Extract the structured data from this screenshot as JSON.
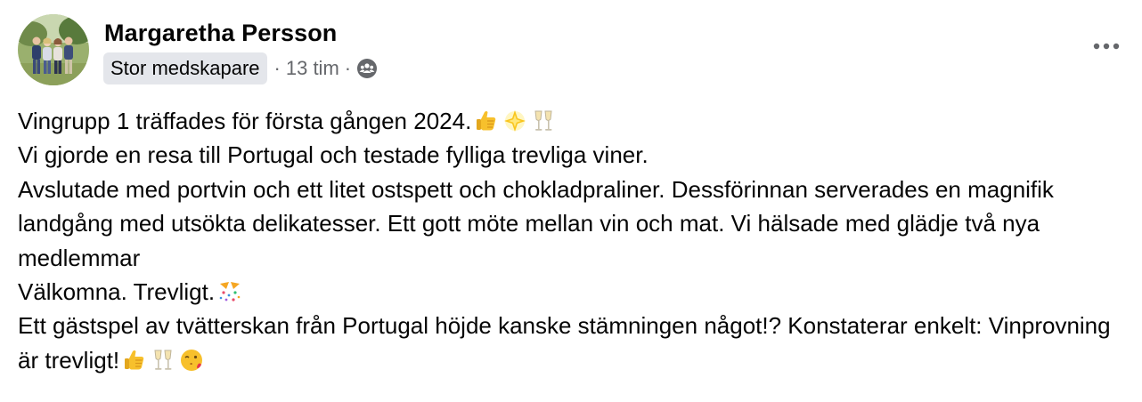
{
  "author": {
    "name": "Margaretha Persson",
    "badge": "Stor medskapare",
    "separator": "·",
    "time": "13 tim",
    "audience_icon": "group-audience-icon"
  },
  "menu": {
    "more_icon": "more-horizontal-icon"
  },
  "post": {
    "lines": [
      "Vingrupp 1 träffades för första gången 2024.",
      "Vi gjorde en resa till Portugal och testade fylliga trevliga viner.",
      "Avslutade med portvin och ett litet ostspett och chokladpraliner. Dessförinnan serverades en magnifik landgång med utsökta delikatesser.  Ett gott möte mellan vin och mat. Vi hälsade med glädje två nya medlemmar",
      "Välkomna. Trevligt.",
      "Ett gästspel av tvätterskan från Portugal höjde kanske stämningen något!? Konstaterar enkelt: Vinprovning är trevligt!"
    ],
    "line1_emojis": [
      "thumbs-up-emoji",
      "glowing-star-emoji",
      "clinking-glasses-emoji"
    ],
    "line4_emojis": [
      "party-popper-emoji"
    ],
    "line5_emojis": [
      "thumbs-up-emoji",
      "clinking-glasses-emoji",
      "face-blowing-kiss-emoji"
    ]
  },
  "colors": {
    "text": "#050505",
    "secondary": "#65676b",
    "badge_bg": "#e4e6eb"
  }
}
